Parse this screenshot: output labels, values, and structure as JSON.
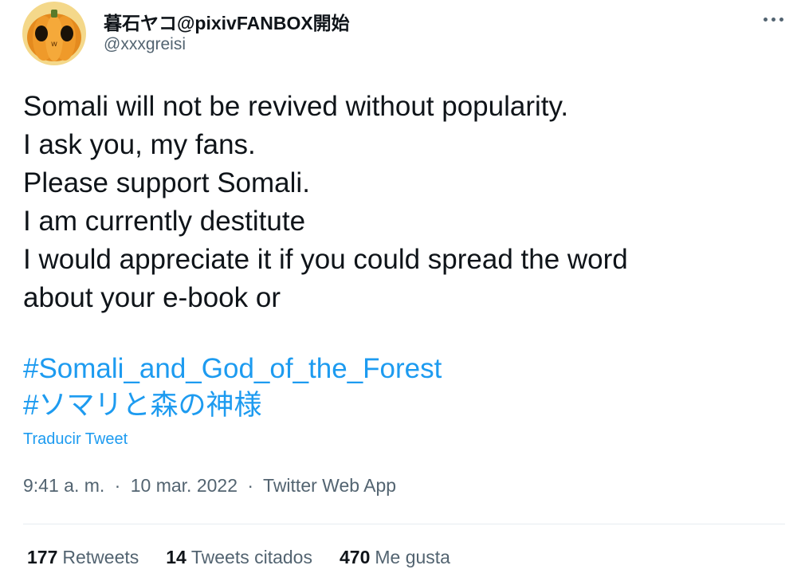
{
  "author": {
    "display_name": "暮石ヤコ@pixivFANBOX開始",
    "handle": "@xxxgreisi",
    "avatar_icon": "pumpkin-avatar-icon"
  },
  "more_icon": "more-options-icon",
  "tweet": {
    "lines": [
      "Somali will not be revived without popularity.",
      "I ask you, my fans.",
      "Please support Somali.",
      "I am currently destitute",
      "I would appreciate it if you could spread the word",
      "about your e-book or"
    ],
    "hashtags": [
      "#Somali_and_God_of_the_Forest",
      "#ソマリと森の神様"
    ],
    "translate_label": "Traducir Tweet"
  },
  "meta": {
    "time": "9:41 a. m.",
    "separator": "·",
    "date": "10 mar. 2022",
    "source": "Twitter Web App"
  },
  "stats": {
    "retweets": {
      "count": "177",
      "label": "Retweets"
    },
    "quotes": {
      "count": "14",
      "label": "Tweets citados"
    },
    "likes": {
      "count": "470",
      "label": "Me gusta"
    }
  },
  "colors": {
    "link": "#1d9bf0",
    "text": "#0f1419",
    "secondary": "#536471",
    "divider": "#e6ecf0"
  }
}
